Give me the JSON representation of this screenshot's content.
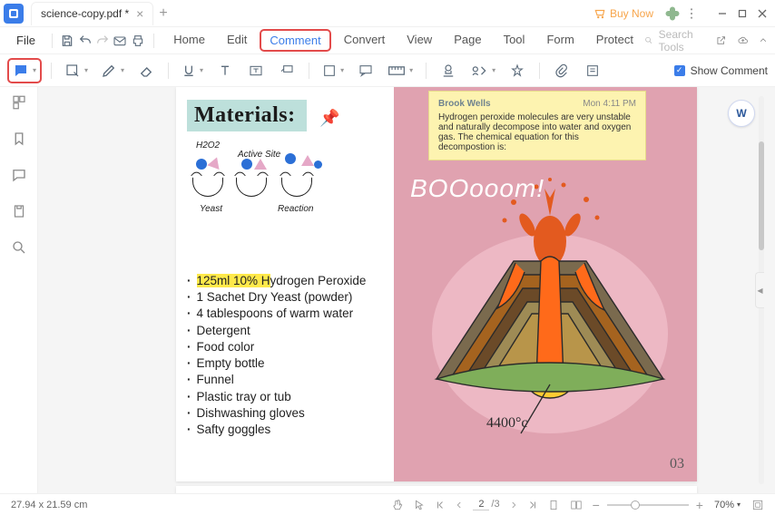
{
  "titlebar": {
    "tab_title": "science-copy.pdf *",
    "buy_now": "Buy Now"
  },
  "menubar": {
    "file": "File",
    "tabs": [
      "Home",
      "Edit",
      "Comment",
      "Convert",
      "View",
      "Page",
      "Tool",
      "Form",
      "Protect"
    ],
    "active_tab_index": 2,
    "search_placeholder": "Search Tools"
  },
  "toolbar": {
    "show_comment_label": "Show Comment"
  },
  "document": {
    "materials_heading": "Materials:",
    "diagram": {
      "h2o2": "H2O2",
      "active_site": "Active Site",
      "yeast": "Yeast",
      "reaction": "Reaction"
    },
    "materials_list": [
      "125ml 10% Hydrogen Peroxide",
      "1 Sachet Dry Yeast (powder)",
      "4 tablespoons of warm water",
      "Detergent",
      "Food color",
      "Empty bottle",
      "Funnel",
      "Plastic tray or tub",
      "Dishwashing gloves",
      "Safty goggles"
    ],
    "highlight_fragment": "125ml 10% H",
    "sticky": {
      "author": "Brook Wells",
      "time": "Mon 4:11 PM",
      "body": "Hydrogen peroxide molecules are very unstable and naturally decompose into water and oxygen gas. The chemical equation for this decompostion is:"
    },
    "boom_text": "BOOooom!",
    "temperature": "4400°c",
    "page_number": "03"
  },
  "statusbar": {
    "dimensions": "27.94 x 21.59 cm",
    "current_page": "2",
    "total_pages": "/3",
    "zoom": "70%"
  }
}
